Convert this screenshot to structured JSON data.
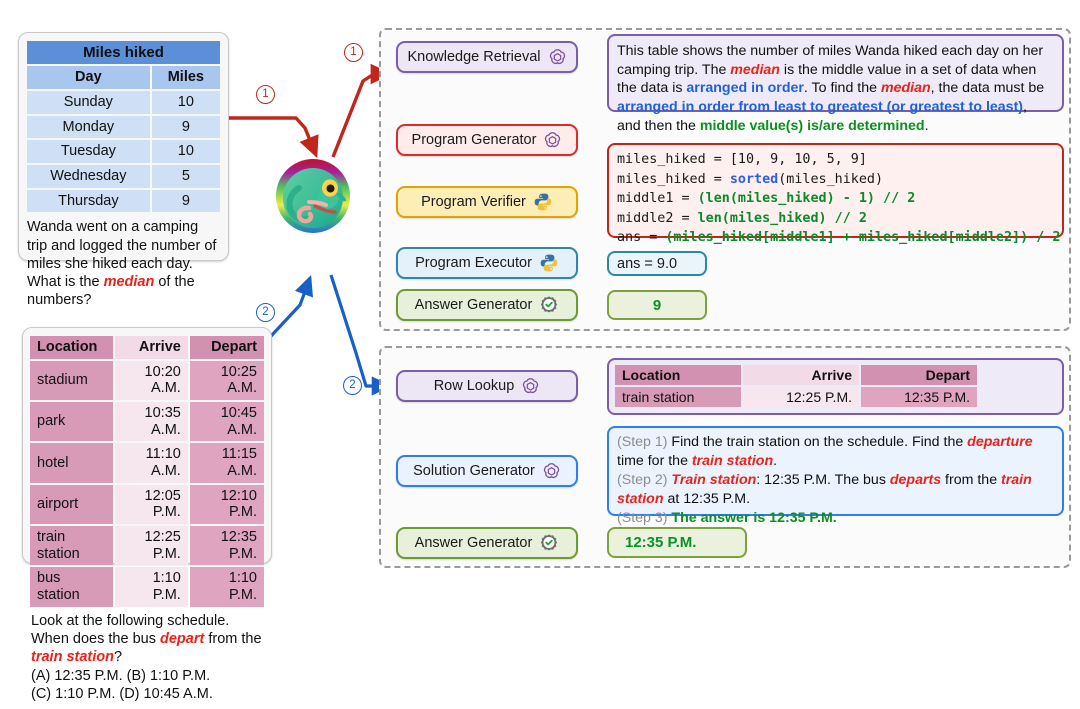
{
  "left": {
    "miles_card": {
      "caption": "Miles hiked",
      "headers": [
        "Day",
        "Miles"
      ],
      "rows": [
        [
          "Sunday",
          "10"
        ],
        [
          "Monday",
          "9"
        ],
        [
          "Tuesday",
          "10"
        ],
        [
          "Wednesday",
          "5"
        ],
        [
          "Thursday",
          "9"
        ]
      ],
      "question_pre": "Wanda went on a camping trip and logged the number of miles she hiked each day. What is the ",
      "question_em": "median",
      "question_post": " of the numbers?"
    },
    "schedule_card": {
      "headers": [
        "Location",
        "Arrive",
        "Depart"
      ],
      "rows": [
        [
          "stadium",
          "10:20 A.M.",
          "10:25 A.M."
        ],
        [
          "park",
          "10:35 A.M.",
          "10:45 A.M."
        ],
        [
          "hotel",
          "11:10 A.M.",
          "11:15 A.M."
        ],
        [
          "airport",
          "12:05 P.M.",
          "12:10 P.M."
        ],
        [
          "train station",
          "12:25 P.M.",
          "12:35 P.M."
        ],
        [
          "bus station",
          "1:10 P.M.",
          "1:10 P.M."
        ]
      ],
      "q_a": "Look at the following schedule. When does the bus ",
      "q_b": "depart",
      "q_c": " from the ",
      "q_d": "train station",
      "q_e": "?",
      "choices_line1": "(A) 12:35 P.M. (B) 1:10 P.M.",
      "choices_line2": "(C) 1:10 P.M. (D) 10:45 A.M."
    }
  },
  "markers": {
    "one": "1",
    "two": "2"
  },
  "panel1": {
    "modules": [
      {
        "label": "Knowledge Retrieval",
        "icon": "openai-icon"
      },
      {
        "label": "Program Generator",
        "icon": "openai-icon"
      },
      {
        "label": "Program Verifier",
        "icon": "python-icon"
      },
      {
        "label": "Program Executor",
        "icon": "python-icon"
      },
      {
        "label": "Answer Generator",
        "icon": "check-gear-icon"
      }
    ],
    "knowledge_text": {
      "p1": "This table shows the number of miles Wanda hiked each day on her camping trip. The ",
      "em1": "median",
      "p2": " is the middle value in a set of data when the data is ",
      "b1": "arranged in order",
      "p3": ". To find the ",
      "em2": "median",
      "p4": ", the data must be ",
      "b2": "arranged in order from least to greatest (or greatest to least)",
      "p5": ", and then the ",
      "g1": "middle value(s) is/are determined",
      "p6": "."
    },
    "code": {
      "line1_a": "miles_hiked = [10, 9, 10, 5, 9]",
      "line2_a": "miles_hiked = ",
      "line2_fn": "sorted",
      "line2_b": "(miles_hiked)",
      "line3_a": "middle1 = ",
      "line3_g": "(len(miles_hiked) - 1) // 2",
      "line4_a": "middle2 = ",
      "line4_g": "len(miles_hiked) // 2",
      "line5_a": "ans = ",
      "line5_g": "(miles_hiked[middle1] + miles_hiked[middle2]) / 2"
    },
    "executor_output": "ans = 9.0",
    "final_answer": "9"
  },
  "panel2": {
    "modules": [
      {
        "label": "Row Lookup",
        "icon": "openai-icon"
      },
      {
        "label": "Solution Generator",
        "icon": "openai-icon"
      },
      {
        "label": "Answer Generator",
        "icon": "check-gear-icon"
      }
    ],
    "row_lookup_table": {
      "headers": [
        "Location",
        "Arrive",
        "Depart"
      ],
      "rows": [
        [
          "train station",
          "12:25 P.M.",
          "12:35 P.M."
        ]
      ]
    },
    "solution": {
      "s1_tag": "(Step 1)",
      "s1_a": " Find the train station on the schedule. Find the ",
      "s1_r1": "departure",
      "s1_b": " time for the ",
      "s1_r2": "train station",
      "s1_c": ".",
      "s2_tag": "(Step 2)",
      "s2_r1": " Train station",
      "s2_a": ": 12:35 P.M. The bus ",
      "s2_r2": "departs",
      "s2_b": " from the ",
      "s2_r3": "train station",
      "s2_c": " at 12:35 P.M.",
      "s3_tag": "(Step 3)",
      "s3_g": " The answer is 12:35 P.M."
    },
    "final_answer": "12:35 P.M."
  },
  "colors": {
    "red_arrow": "#c0261b",
    "blue_arrow": "#1a5fc8",
    "purple": "#7a5ea8",
    "green": "#7ba23c",
    "cyan": "#2f87a8",
    "blue": "#2f7ef0",
    "answer_green": "#0a9226"
  }
}
